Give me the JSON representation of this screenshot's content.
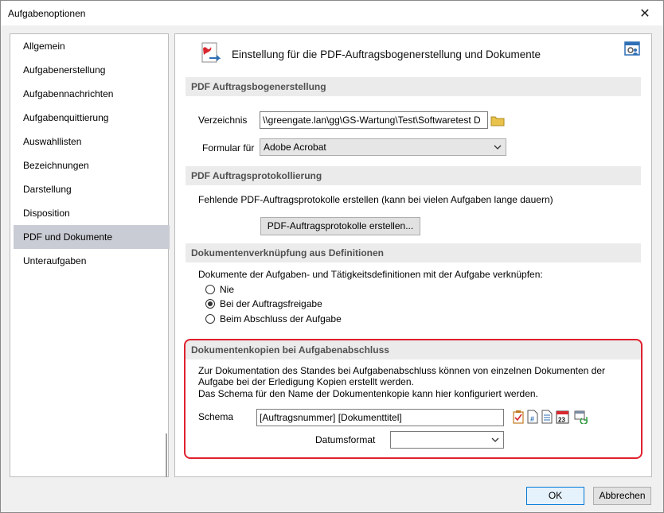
{
  "window": {
    "title": "Aufgabenoptionen",
    "close_glyph": "✕"
  },
  "nav": {
    "items": [
      {
        "label": "Allgemein"
      },
      {
        "label": "Aufgabenerstellung"
      },
      {
        "label": "Aufgabennachrichten"
      },
      {
        "label": "Aufgabenquittierung"
      },
      {
        "label": "Auswahllisten"
      },
      {
        "label": "Bezeichnungen"
      },
      {
        "label": "Darstellung"
      },
      {
        "label": "Disposition"
      },
      {
        "label": "PDF und Dokumente",
        "selected": true
      },
      {
        "label": "Unteraufgaben"
      }
    ]
  },
  "header": {
    "title": "Einstellung für die PDF-Auftragsbogenerstellung und Dokumente",
    "icon": "pdf-document-icon",
    "corner_icon": "settings-user-icon"
  },
  "pdf_creation": {
    "heading": "PDF Auftragsbogenerstellung",
    "directory_label": "Verzeichnis",
    "directory_value": "\\\\greengate.lan\\gg\\GS-Wartung\\Test\\Softwaretest D",
    "form_label": "Formular für",
    "form_value": "Adobe Acrobat"
  },
  "pdf_logging": {
    "heading": "PDF Auftragsprotokollierung",
    "description": "Fehlende PDF-Auftragsprotokolle erstellen (kann bei vielen Aufgaben lange dauern)",
    "button_label": "PDF-Auftragsprotokolle erstellen..."
  },
  "doc_linking": {
    "heading": "Dokumentenverknüpfung aus Definitionen",
    "description": "Dokumente der Aufgaben- und Tätigkeitsdefinitionen mit der Aufgabe verknüpfen:",
    "options": [
      {
        "label": "Nie",
        "checked": false
      },
      {
        "label": "Bei der Auftragsfreigabe",
        "checked": true
      },
      {
        "label": "Beim Abschluss der Aufgabe",
        "checked": false
      }
    ]
  },
  "doc_copies": {
    "heading": "Dokumentenkopien bei Aufgabenabschluss",
    "line1": "Zur Dokumentation des Standes bei Aufgabenabschluss können von einzelnen Dokumenten der",
    "line2": "Aufgabe bei der Erledigung Kopien erstellt werden.",
    "line3": "Das Schema für den Name der Dokumentenkopie kann hier konfiguriert werden.",
    "schema_label": "Schema",
    "schema_value": "[Auftragsnummer] [Dokumenttitel]",
    "date_format_label": "Datumsformat",
    "date_format_value": "",
    "icons": [
      "task-checklist-icon",
      "number-field-icon",
      "document-field-icon",
      "calendar-date-icon",
      "refresh-field-icon"
    ],
    "highlight_color": "#e0212e"
  },
  "footer": {
    "ok_label": "OK",
    "cancel_label": "Abbrechen"
  }
}
